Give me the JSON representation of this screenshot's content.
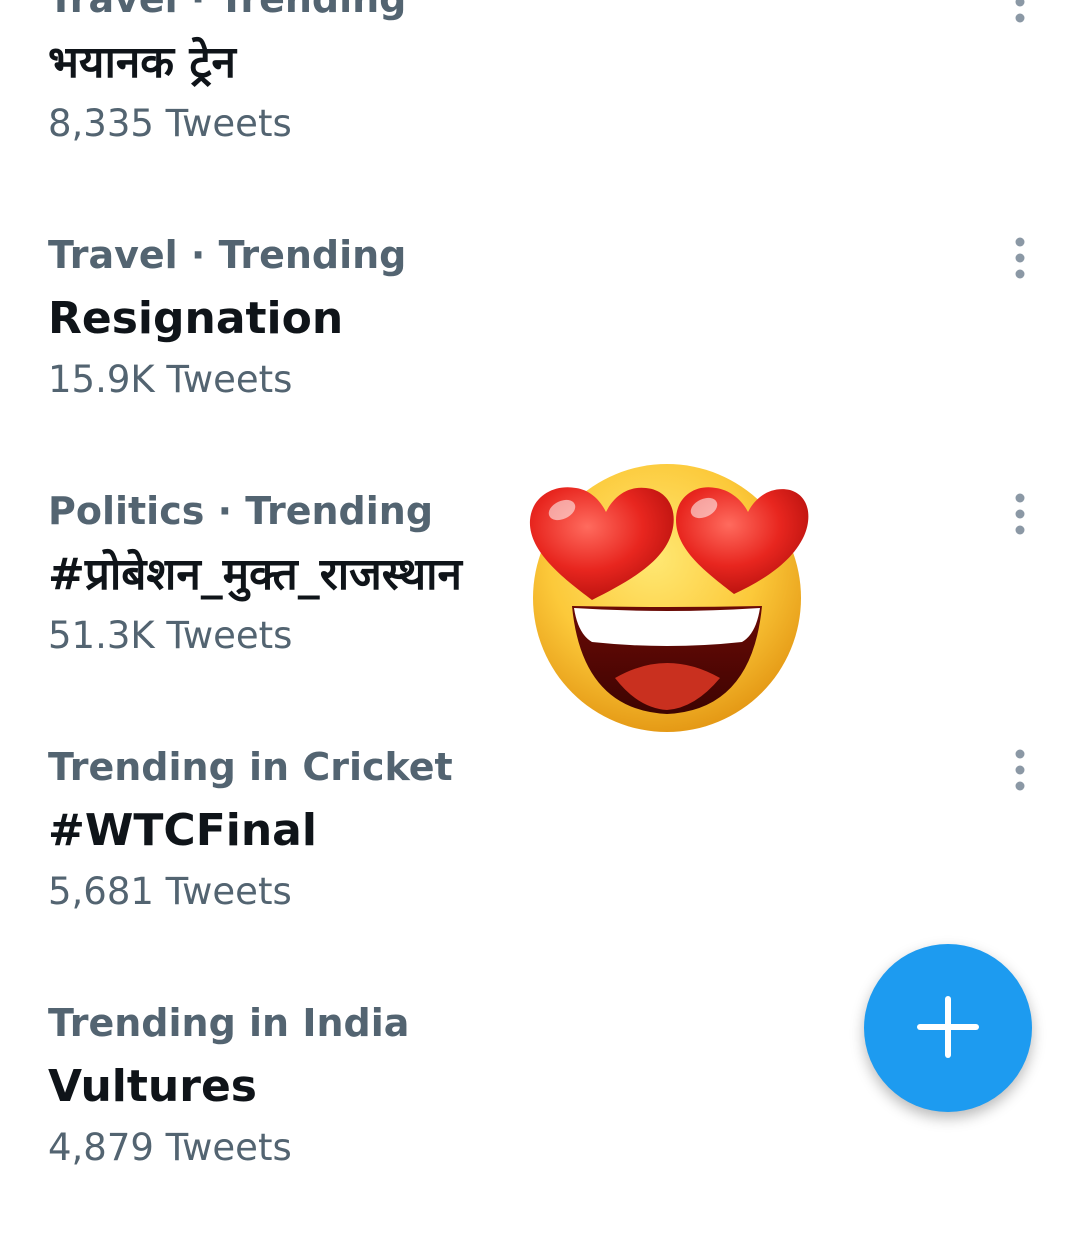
{
  "trends": [
    {
      "context": "Travel · Trending",
      "title": "भयानक ट्रेन",
      "count": "8,335 Tweets"
    },
    {
      "context": "Travel · Trending",
      "title": "Resignation",
      "count": "15.9K Tweets"
    },
    {
      "context": "Politics · Trending",
      "title": "#प्रोबेशन_मुक्त_राजस्थान",
      "count": "51.3K Tweets"
    },
    {
      "context": "Trending in Cricket",
      "title": "#WTCFinal",
      "count": "5,681 Tweets"
    },
    {
      "context": "Trending in India",
      "title": "Vultures",
      "count": "4,879 Tweets"
    }
  ],
  "icons": {
    "more": "more-vertical-icon",
    "compose": "plus-icon",
    "sticker": "heart-eyes-emoji"
  },
  "colors": {
    "accent": "#1d9bf0",
    "primary_text": "#0f1419",
    "secondary_text": "#536471",
    "icon_gray": "#8b98a5"
  }
}
